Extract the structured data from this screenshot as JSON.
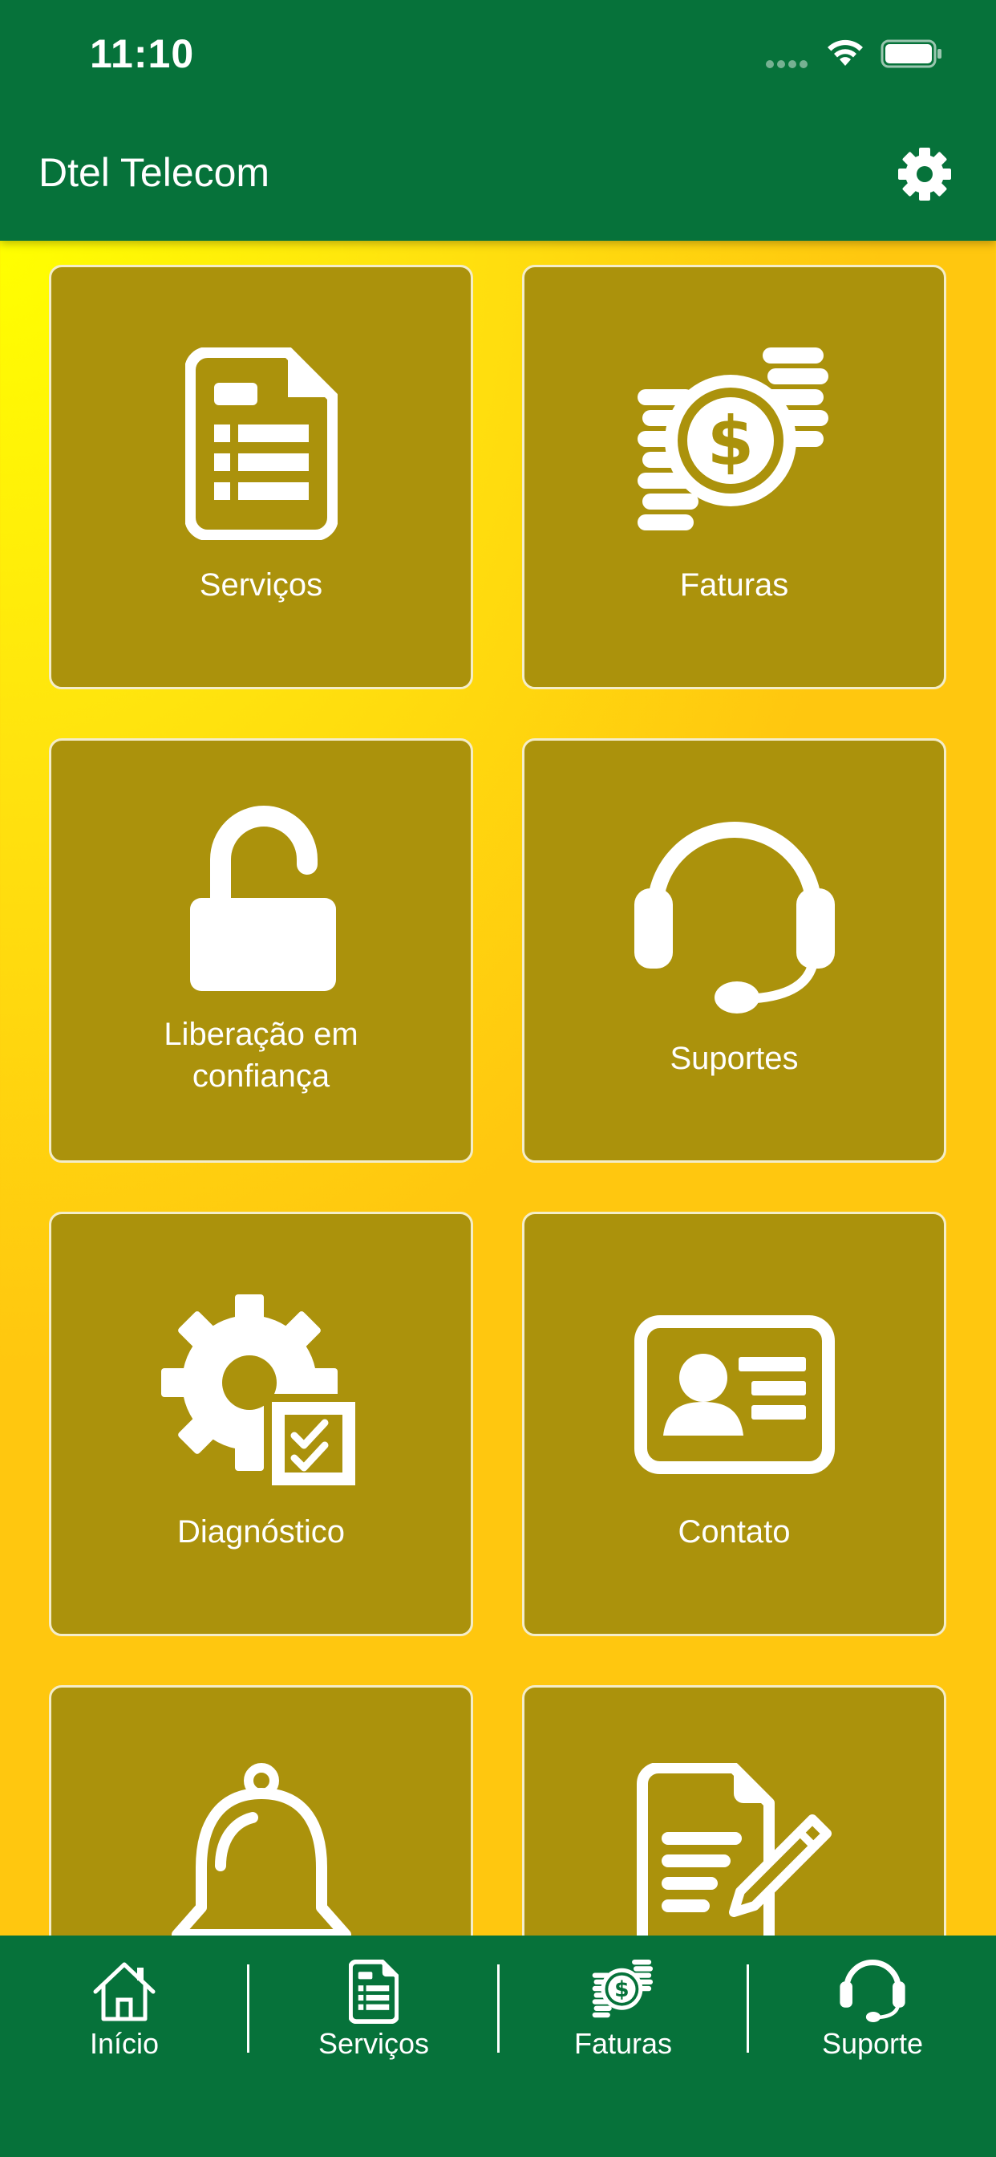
{
  "status_bar": {
    "time": "11:10"
  },
  "header": {
    "title": "Dtel Telecom",
    "settings_icon": "gear-icon"
  },
  "tiles": [
    {
      "label": "Serviços",
      "icon": "document-list-icon"
    },
    {
      "label": "Faturas",
      "icon": "coins-dollar-icon"
    },
    {
      "label": "Liberação em\nconfiança",
      "icon": "unlock-icon"
    },
    {
      "label": "Suportes",
      "icon": "headset-icon"
    },
    {
      "label": "Diagnóstico",
      "icon": "gear-checklist-icon"
    },
    {
      "label": "Contato",
      "icon": "contact-card-icon"
    },
    {
      "label": "",
      "icon": "bell-icon"
    },
    {
      "label": "",
      "icon": "document-edit-icon"
    }
  ],
  "tabbar": {
    "items": [
      {
        "label": "Início",
        "icon": "home-icon"
      },
      {
        "label": "Serviços",
        "icon": "document-list-icon"
      },
      {
        "label": "Faturas",
        "icon": "coins-dollar-icon"
      },
      {
        "label": "Suporte",
        "icon": "headset-icon"
      }
    ]
  },
  "colors": {
    "header_bg": "#06723a",
    "tile_bg": "#ab920c",
    "tile_border": "#f4edc9",
    "background_yellow": "#ffe40e",
    "text": "#ffffff"
  }
}
